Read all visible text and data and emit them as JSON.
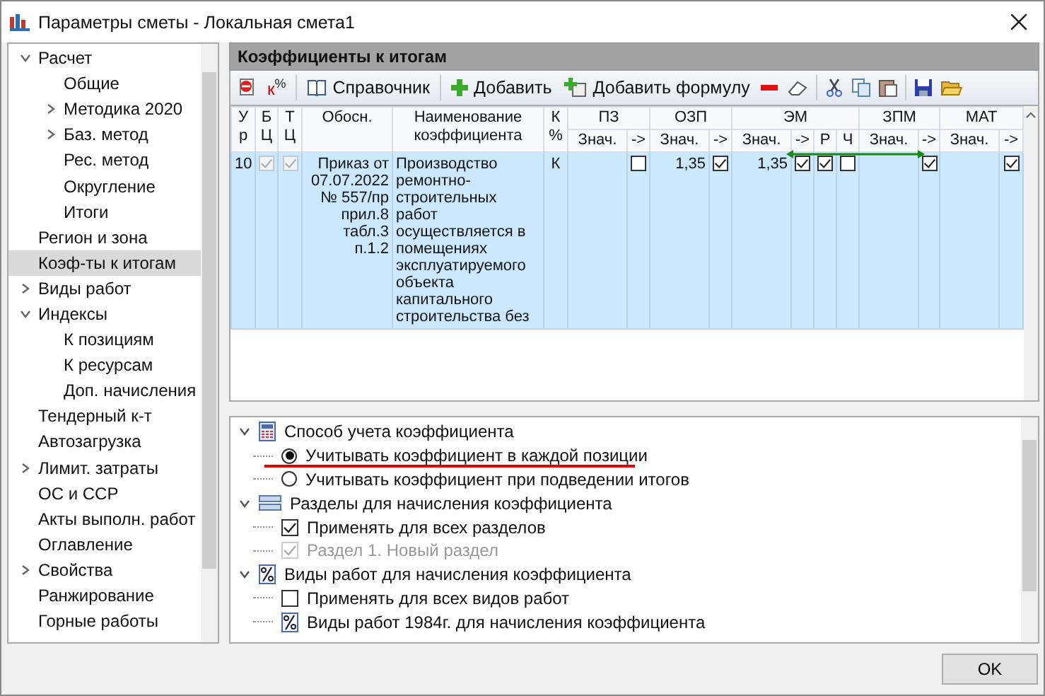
{
  "window": {
    "title": "Параметры сметы - Локальная смета1"
  },
  "sidebar": {
    "items": [
      {
        "label": "Расчет",
        "expanded": true,
        "selected": false,
        "children": [
          {
            "label": "Общие",
            "selected": false
          },
          {
            "label": "Методика 2020",
            "expanded": false,
            "selected": false
          },
          {
            "label": "Баз. метод",
            "expanded": false,
            "selected": false
          },
          {
            "label": "Рес. метод",
            "selected": false
          },
          {
            "label": "Округление",
            "selected": false
          },
          {
            "label": "Итоги",
            "selected": false
          }
        ]
      },
      {
        "label": "Регион и зона",
        "selected": false
      },
      {
        "label": "Коэф-ты к итогам",
        "selected": true
      },
      {
        "label": "Виды работ",
        "expanded": false,
        "selected": false
      },
      {
        "label": "Индексы",
        "expanded": true,
        "selected": false,
        "children": [
          {
            "label": "К позициям",
            "selected": false
          },
          {
            "label": "К ресурсам",
            "selected": false
          },
          {
            "label": "Доп. начисления",
            "selected": false
          }
        ]
      },
      {
        "label": "Тендерный к-т",
        "selected": false
      },
      {
        "label": "Автозагрузка",
        "selected": false
      },
      {
        "label": "Лимит. затраты",
        "expanded": false,
        "selected": false
      },
      {
        "label": "ОС и ССР",
        "selected": false
      },
      {
        "label": "Акты выполн. работ",
        "selected": false
      },
      {
        "label": "Оглавление",
        "selected": false
      },
      {
        "label": "Свойства",
        "expanded": false,
        "selected": false
      },
      {
        "label": "Ранжирование",
        "selected": false
      },
      {
        "label": "Горные работы",
        "selected": false
      }
    ]
  },
  "panel": {
    "title": "Коэффициенты к итогам"
  },
  "toolbar": {
    "k_percent": "к$^{%}$",
    "reference": "Справочник",
    "add": "Добавить",
    "add_formula": "Добавить формулу"
  },
  "table": {
    "columns": [
      "Ур",
      "БЦ",
      "ТЦ",
      "Обосн.",
      "Наименование коэффициента",
      "К %"
    ],
    "groups": [
      {
        "label": "ПЗ",
        "subcolumns": [
          "Знач.",
          "->"
        ]
      },
      {
        "label": "ОЗП",
        "subcolumns": [
          "Знач.",
          "->"
        ]
      },
      {
        "label": "ЭМ",
        "subcolumns": [
          "Знач.",
          "->",
          "Р",
          "Ч"
        ]
      },
      {
        "label": "ЗПМ",
        "subcolumns": [
          "Знач.",
          "->"
        ]
      },
      {
        "label": "МАТ",
        "subcolumns": [
          "Знач.",
          "->"
        ]
      }
    ],
    "rows": [
      {
        "selected": true,
        "level": "10",
        "bc_checked": true,
        "tc_checked": true,
        "basis": "Приказ от\n07.07.2022\n№ 557/пр\nприл.8\nтабл.3\nп.1.2",
        "name": "Производство\nремонтно-\nстроительных работ\nосуществляется в\nпомещениях\nэксплуатируемого\nобъекта\nкапитального\nстроительства без",
        "k": "К",
        "group_cells": [
          {
            "kind": "value"
          },
          {
            "kind": "check",
            "checked": false
          },
          {
            "kind": "value",
            "text": "1,35"
          },
          {
            "kind": "check",
            "checked": true
          },
          {
            "kind": "value",
            "text": "1,35"
          },
          {
            "kind": "check",
            "checked": true
          },
          {
            "kind": "check",
            "checked": true
          },
          {
            "kind": "check",
            "checked": false
          },
          {
            "kind": "value"
          },
          {
            "kind": "check",
            "checked": true
          },
          {
            "kind": "value"
          },
          {
            "kind": "check",
            "checked": true
          }
        ]
      }
    ]
  },
  "options_tree": [
    {
      "kind": "calculator",
      "label": "Способ учета коэффициента",
      "expanded": true,
      "children": [
        {
          "kind": "radio",
          "label": "Учитывать коэффициент в каждой позиции",
          "selected": true
        },
        {
          "kind": "radio",
          "label": "Учитывать коэффициент при подведении итогов",
          "selected": false
        }
      ]
    },
    {
      "kind": "sections",
      "label": "Разделы для начисления коэффициента",
      "expanded": true,
      "children": [
        {
          "kind": "checkbox",
          "label": "Применять для всех разделов",
          "checked": true,
          "disabled": false
        },
        {
          "kind": "checkbox",
          "label": "Раздел 1. Новый раздел",
          "checked": true,
          "disabled": true
        }
      ]
    },
    {
      "kind": "percent",
      "label": "Виды работ для начисления коэффициента",
      "expanded": true,
      "children": [
        {
          "kind": "checkbox",
          "label": "Применять для всех видов работ",
          "checked": false,
          "disabled": false
        },
        {
          "kind": "percent",
          "label": "Виды работ 1984г. для начисления коэффициента"
        }
      ]
    }
  ],
  "buttons": {
    "ok": "OK"
  }
}
